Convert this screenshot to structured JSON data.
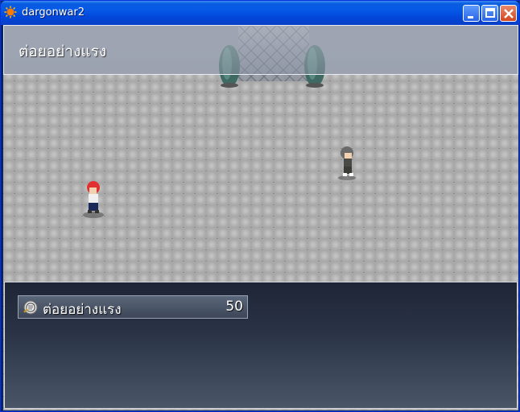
{
  "window": {
    "title": "dargonwar2"
  },
  "message": {
    "skill_text": "ต่อยอย่างแรง"
  },
  "skill_list": {
    "items": [
      {
        "name": "ต่อยอย่างแรง",
        "cost": "50",
        "icon": "fist-icon"
      }
    ]
  },
  "colors": {
    "titlebar": "#0458e6",
    "panel_bg": "#2a3346",
    "floor": "#b6b6b6"
  }
}
